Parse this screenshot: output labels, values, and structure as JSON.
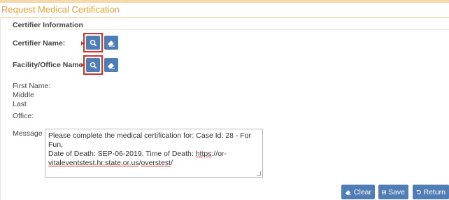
{
  "panel": {
    "title": "Request Medical Certification"
  },
  "certifier": {
    "section_title": "Certifier Information",
    "certifier_name_label": "Certifier Name:",
    "facility_label": "Facility/Office Name:",
    "first_name_label": "First Name:",
    "middle_label": "Middle",
    "last_label": "Last",
    "office_label": "Office:"
  },
  "message": {
    "label": "Message",
    "text_line1": "Please complete the medical certification for: Case Id: 28 - For Fun,",
    "text_line2_a": "Date of Death: SEP-06-2019. Time of Death:  ",
    "text_line2_link": "https",
    "text_line2_b": "://or-",
    "text_line3_u1": "vitaleventstest.hr.state.or.us",
    "text_line3_mid": "/",
    "text_line3_u2": "overstest",
    "text_line3_end": "/"
  },
  "actions": {
    "clear_label": "Clear",
    "save_label": "Save",
    "return_label": "Return"
  },
  "colors": {
    "title": "#f0a030",
    "button": "#4f7eb6",
    "highlight": "#d9302b"
  },
  "icons": [
    "search-icon",
    "eraser-icon",
    "save-icon",
    "undo-icon"
  ]
}
